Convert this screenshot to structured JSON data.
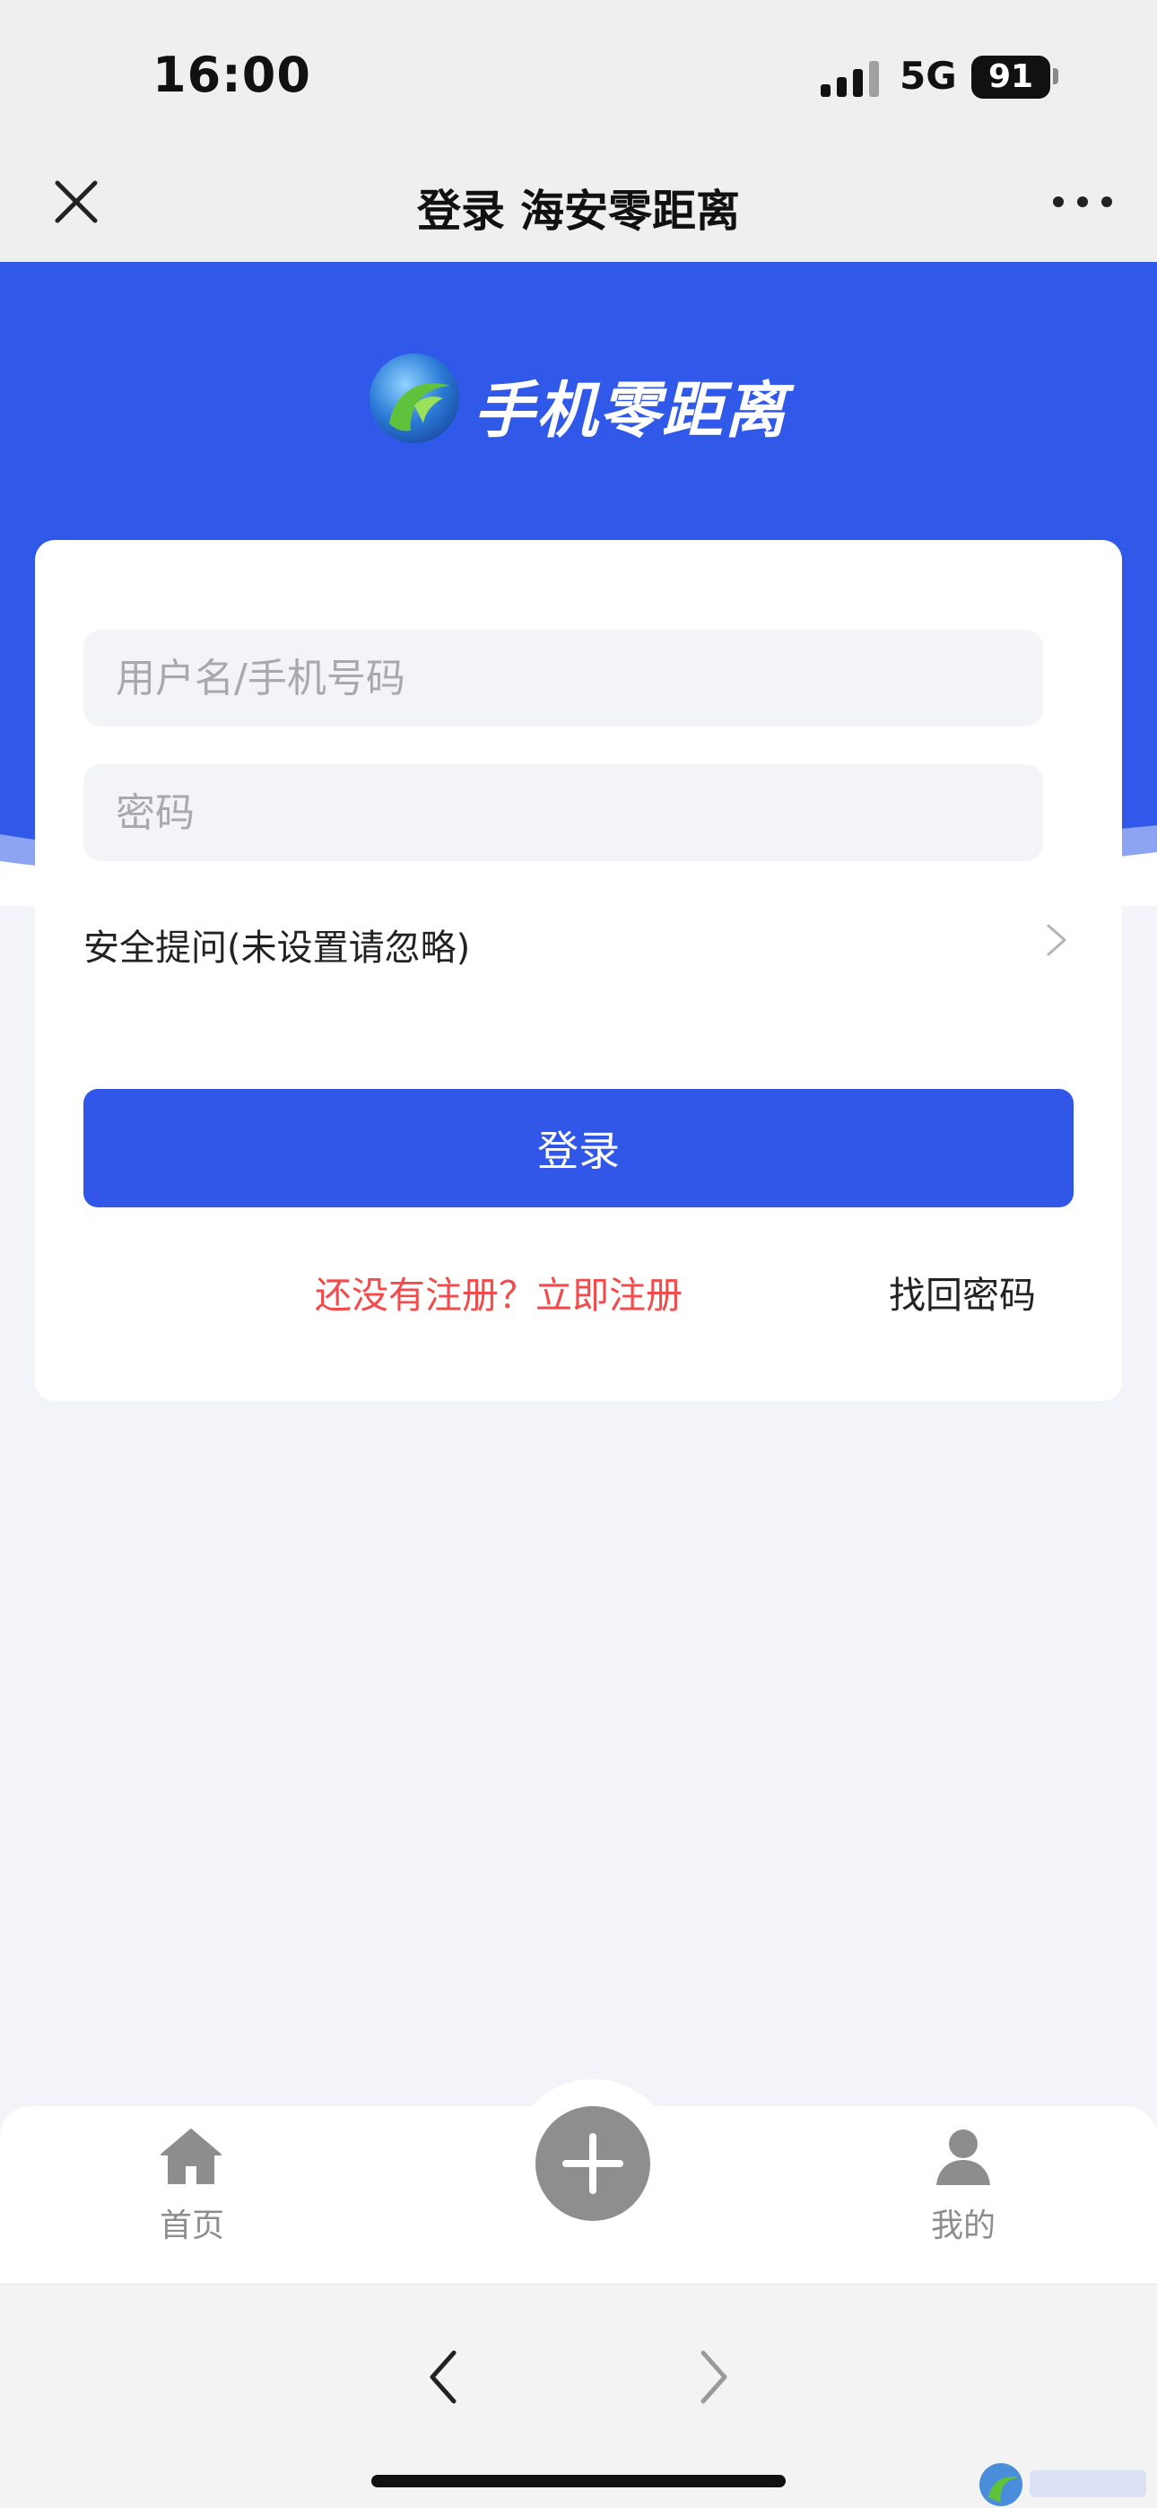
{
  "status_bar": {
    "time": "16:00",
    "network": "5G",
    "battery": "91"
  },
  "header": {
    "title": "登录 海安零距离",
    "close_icon": "close-icon",
    "more_icon": "more-icon"
  },
  "hero": {
    "logo_text": "手机零距离",
    "logo_icon": "globe-logo-icon"
  },
  "login_form": {
    "username_placeholder": "用户名/手机号码",
    "username_value": "",
    "password_placeholder": "密码",
    "password_value": "",
    "security_question_label": "安全提问(未设置请忽略)",
    "login_button_label": "登录",
    "register_link": "还没有注册？立即注册",
    "forgot_password_link": "找回密码"
  },
  "tab_bar": {
    "items": [
      {
        "label": "首页",
        "icon": "home-icon"
      },
      {
        "label": "",
        "icon": "plus-icon"
      },
      {
        "label": "我的",
        "icon": "user-icon"
      }
    ]
  },
  "browser_nav": {
    "back_icon": "chevron-left-icon",
    "forward_icon": "chevron-right-icon"
  },
  "colors": {
    "brand_blue": "#3159e9",
    "register_red": "#f34b4b",
    "page_background": "#f3f4f9",
    "tab_gray": "#8d8d8d"
  }
}
